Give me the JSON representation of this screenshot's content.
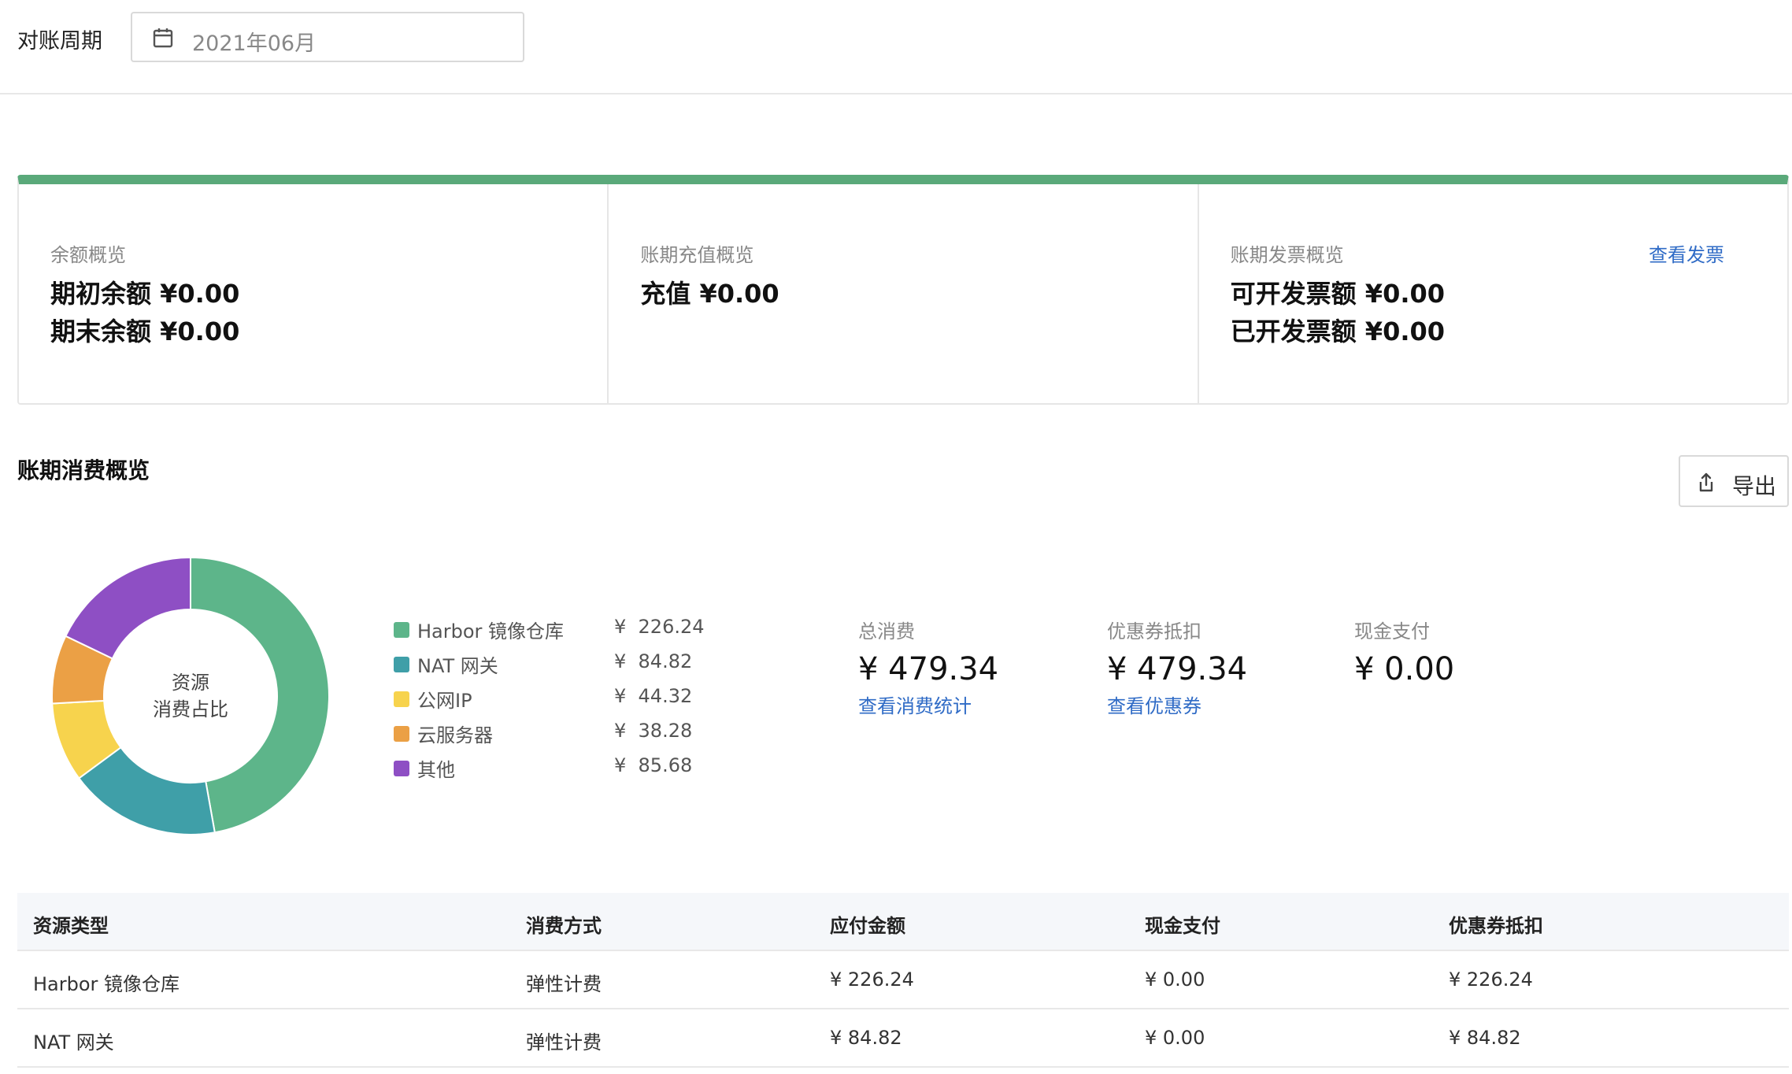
{
  "filter": {
    "label": "对账周期",
    "period_value": "2021年06月"
  },
  "summary": {
    "balance": {
      "title": "余额概览",
      "opening": "期初余额 ¥0.00",
      "closing": "期末余额 ¥0.00"
    },
    "recharge": {
      "title": "账期充值概览",
      "amount": "充值 ¥0.00"
    },
    "invoice": {
      "title": "账期发票概览",
      "link": "查看发票",
      "available": "可开发票额 ¥0.00",
      "issued": "已开发票额 ¥0.00"
    },
    "accent_color": "#5aa97a"
  },
  "consumption": {
    "title": "账期消费概览",
    "export_label": "导出",
    "donut_center_line1": "资源",
    "donut_center_line2": "消费占比",
    "legend": [
      {
        "name": "Harbor 镜像仓库",
        "amount": "¥  226.24",
        "value": 226.24,
        "color": "#5db58a"
      },
      {
        "name": "NAT 网关",
        "amount": "¥  84.82",
        "value": 84.82,
        "color": "#3f9fa8"
      },
      {
        "name": "公网IP",
        "amount": "¥  44.32",
        "value": 44.32,
        "color": "#f7d34d"
      },
      {
        "name": "云服务器",
        "amount": "¥  38.28",
        "value": 38.28,
        "color": "#eba045"
      },
      {
        "name": "其他",
        "amount": "¥  85.68",
        "value": 85.68,
        "color": "#8e4fc4"
      }
    ],
    "stats": {
      "total": {
        "label": "总消费",
        "value": "¥ 479.34",
        "link": "查看消费统计"
      },
      "coupon": {
        "label": "优惠券抵扣",
        "value": "¥ 479.34",
        "link": "查看优惠券"
      },
      "cash": {
        "label": "现金支付",
        "value": "¥ 0.00"
      }
    }
  },
  "table": {
    "headers": [
      "资源类型",
      "消费方式",
      "应付金额",
      "现金支付",
      "优惠券抵扣"
    ],
    "rows": [
      [
        "Harbor 镜像仓库",
        "弹性计费",
        "¥ 226.24",
        "¥ 0.00",
        "¥ 226.24"
      ],
      [
        "NAT 网关",
        "弹性计费",
        "¥ 84.82",
        "¥ 0.00",
        "¥ 84.82"
      ]
    ]
  }
}
